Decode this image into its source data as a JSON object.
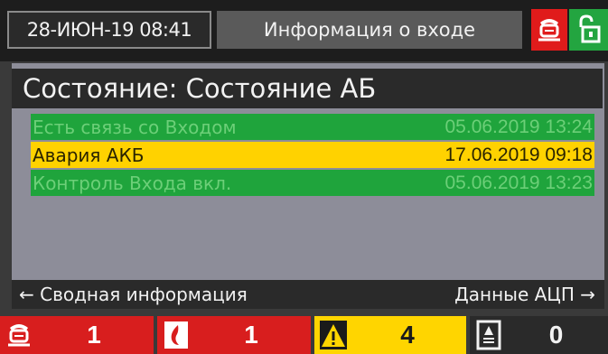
{
  "header": {
    "datetime": "28-ИЮН-19 08:41",
    "title": "Информация о входе",
    "fire_icon": "fire-alarm-icon",
    "lock_icon": "unlocked-icon",
    "colors": {
      "alarm": "#e01b1b",
      "ok": "#23a540"
    }
  },
  "state": {
    "title": "Состояние: Состояние АБ"
  },
  "events": [
    {
      "text": "Есть связь со Входом",
      "time": "05.06.2019 13:24",
      "status": "green"
    },
    {
      "text": "Авария АКБ",
      "time": "17.06.2019 09:18",
      "status": "yellow"
    },
    {
      "text": "Контроль Входа вкл.",
      "time": "05.06.2019 13:23",
      "status": "green"
    }
  ],
  "nav": {
    "left_label": "← Сводная информация",
    "right_label": "Данные АЦП →"
  },
  "counters": [
    {
      "icon": "fire-alarm-icon",
      "count": "1",
      "color": "#d81e1e"
    },
    {
      "icon": "smoke-flame-icon",
      "count": "1",
      "color": "#d81e1e"
    },
    {
      "icon": "warning-icon",
      "count": "4",
      "color": "#ffd500"
    },
    {
      "icon": "disabled-icon",
      "count": "0",
      "color": "#2a2a2a"
    }
  ]
}
